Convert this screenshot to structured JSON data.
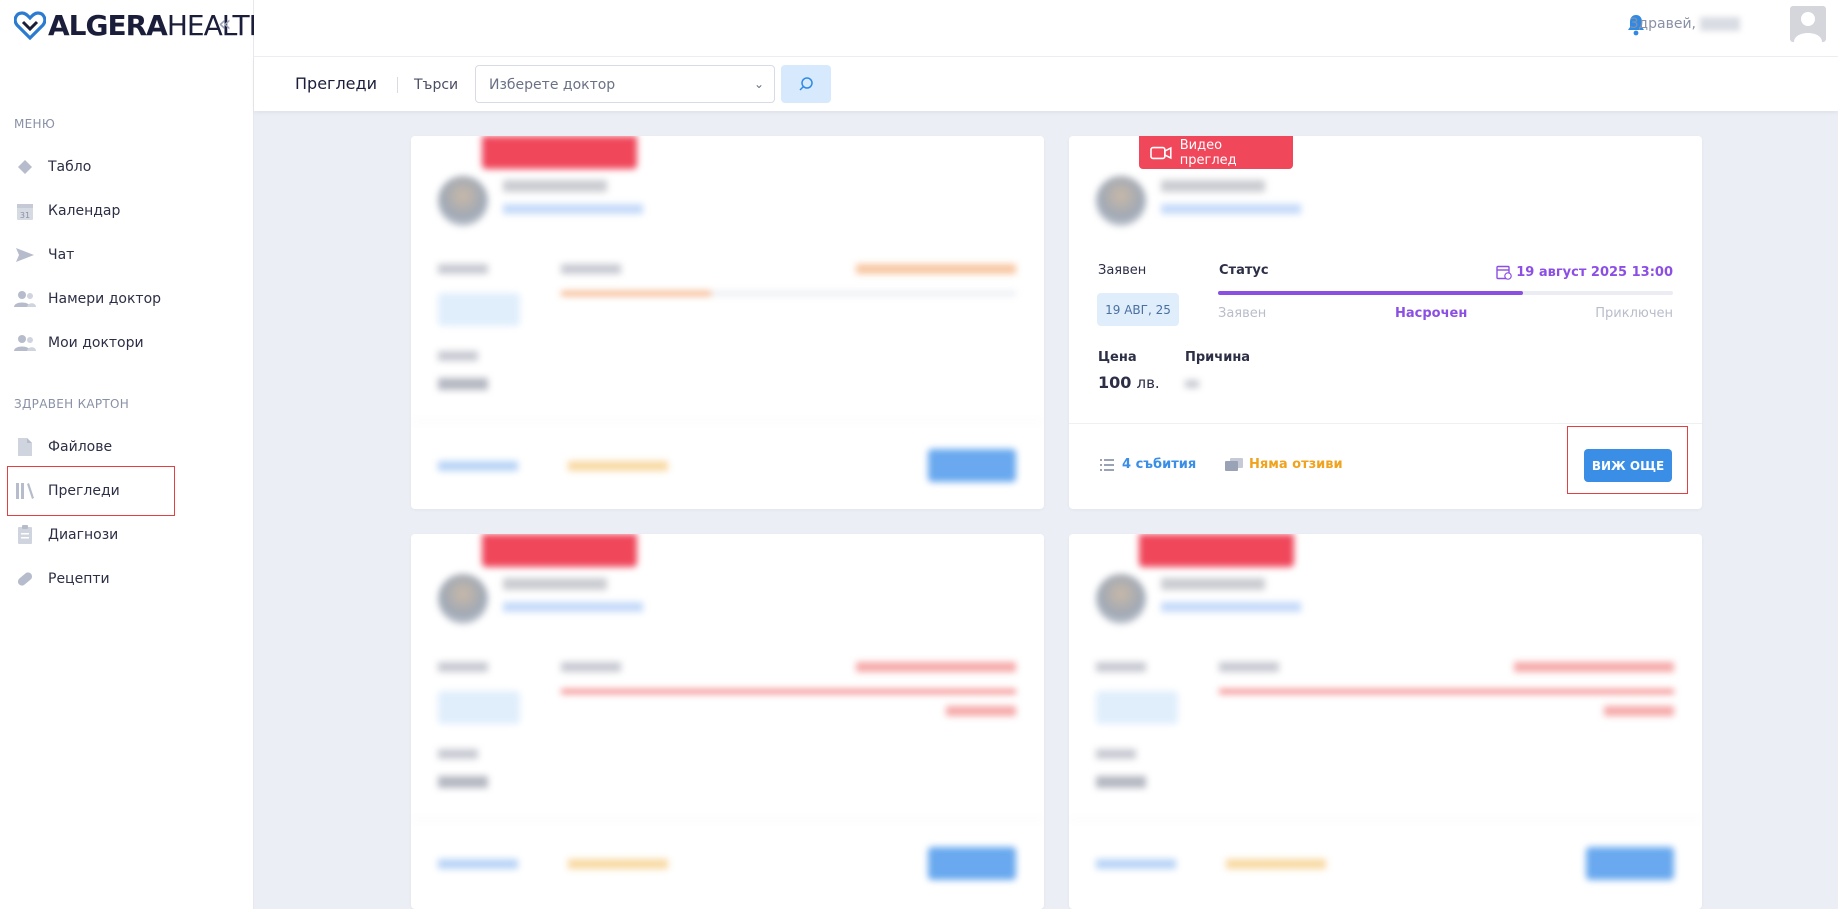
{
  "app": {
    "logo_bold": "ALGERA",
    "logo_light": "HEALTH"
  },
  "sidebar": {
    "menu_section": "МЕНЮ",
    "records_section": "ЗДРАВЕН КАРТОН",
    "items": [
      {
        "label": "Табло",
        "icon": "dashboard-icon"
      },
      {
        "label": "Календар",
        "icon": "calendar-icon"
      },
      {
        "label": "Чат",
        "icon": "send-icon"
      },
      {
        "label": "Намери доктор",
        "icon": "users-icon"
      },
      {
        "label": "Мои доктори",
        "icon": "users-icon"
      },
      {
        "label": "Файлове",
        "icon": "file-icon"
      },
      {
        "label": "Прегледи",
        "icon": "books-icon"
      },
      {
        "label": "Диагнози",
        "icon": "clipboard-icon"
      },
      {
        "label": "Рецепти",
        "icon": "pill-icon"
      }
    ]
  },
  "topbar": {
    "greeting": "Здравей,"
  },
  "subbar": {
    "title": "Прегледи",
    "search_label": "Търси",
    "doctor_select_placeholder": "Изберете доктор"
  },
  "card": {
    "badge": "Видео преглед",
    "requested_label": "Заявен",
    "requested_date": "19 АВГ, 25",
    "status_label": "Статус",
    "scheduled_datetime": "19 август 2025 13:00",
    "steps": [
      "Заявен",
      "Насрочен",
      "Приключен"
    ],
    "progress": 0.67,
    "price_label": "Цена",
    "price_value": "100",
    "price_currency": "лв.",
    "reason_label": "Причина",
    "events": "4 събития",
    "reviews": "Няма отзиви",
    "more_button": "ВИЖ ОЩЕ"
  },
  "colors": {
    "accent": "#3a8ee6",
    "badge": "#f0475b",
    "progress_purple": "#8b4fe4",
    "warning": "#f0a31e",
    "highlight": "#e24141"
  }
}
